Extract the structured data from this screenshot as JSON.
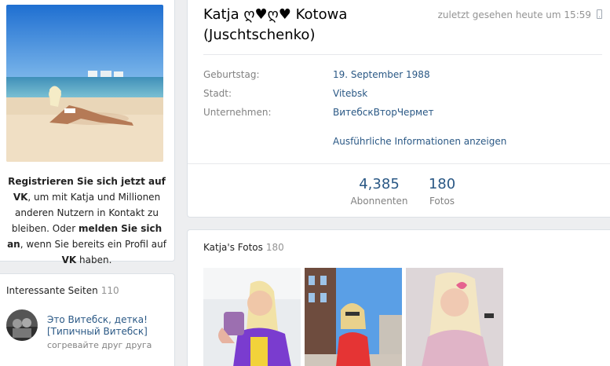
{
  "profile": {
    "name": "Katja ღ♥ღ♥ Kotowa (Juschtschenko)",
    "last_seen": "zuletzt gesehen heute um 15:59",
    "details": [
      {
        "label": "Geburtstag:",
        "value": "19. September 1988"
      },
      {
        "label": "Stadt:",
        "value": "Vitebsk"
      },
      {
        "label": "Unternehmen:",
        "value": "ВитебскВторЧермет"
      }
    ],
    "more_link": "Ausführliche Informationen anzeigen",
    "counters": [
      {
        "value": "4,385",
        "label": "Abonnenten"
      },
      {
        "value": "180",
        "label": "Fotos"
      }
    ]
  },
  "register": {
    "line1_bold": "Registrieren Sie sich jetzt auf VK",
    "line1_rest": ", um mit Katja und Millionen anderen Nutzern in Kontakt zu bleiben. Oder ",
    "login_bold": "melden Sie sich an",
    "line2_rest": ", wenn Sie bereits ein Profil auf ",
    "vk_bold": "VK",
    "end": " haben."
  },
  "interesting_pages": {
    "title": "Interessante Seiten",
    "count": "110",
    "items": [
      {
        "name": "Это Витебск, детка! [Типичный Витебск]",
        "description": "согревайте друг друга"
      }
    ]
  },
  "photos": {
    "title": "Katja's Fotos",
    "count": "180"
  }
}
